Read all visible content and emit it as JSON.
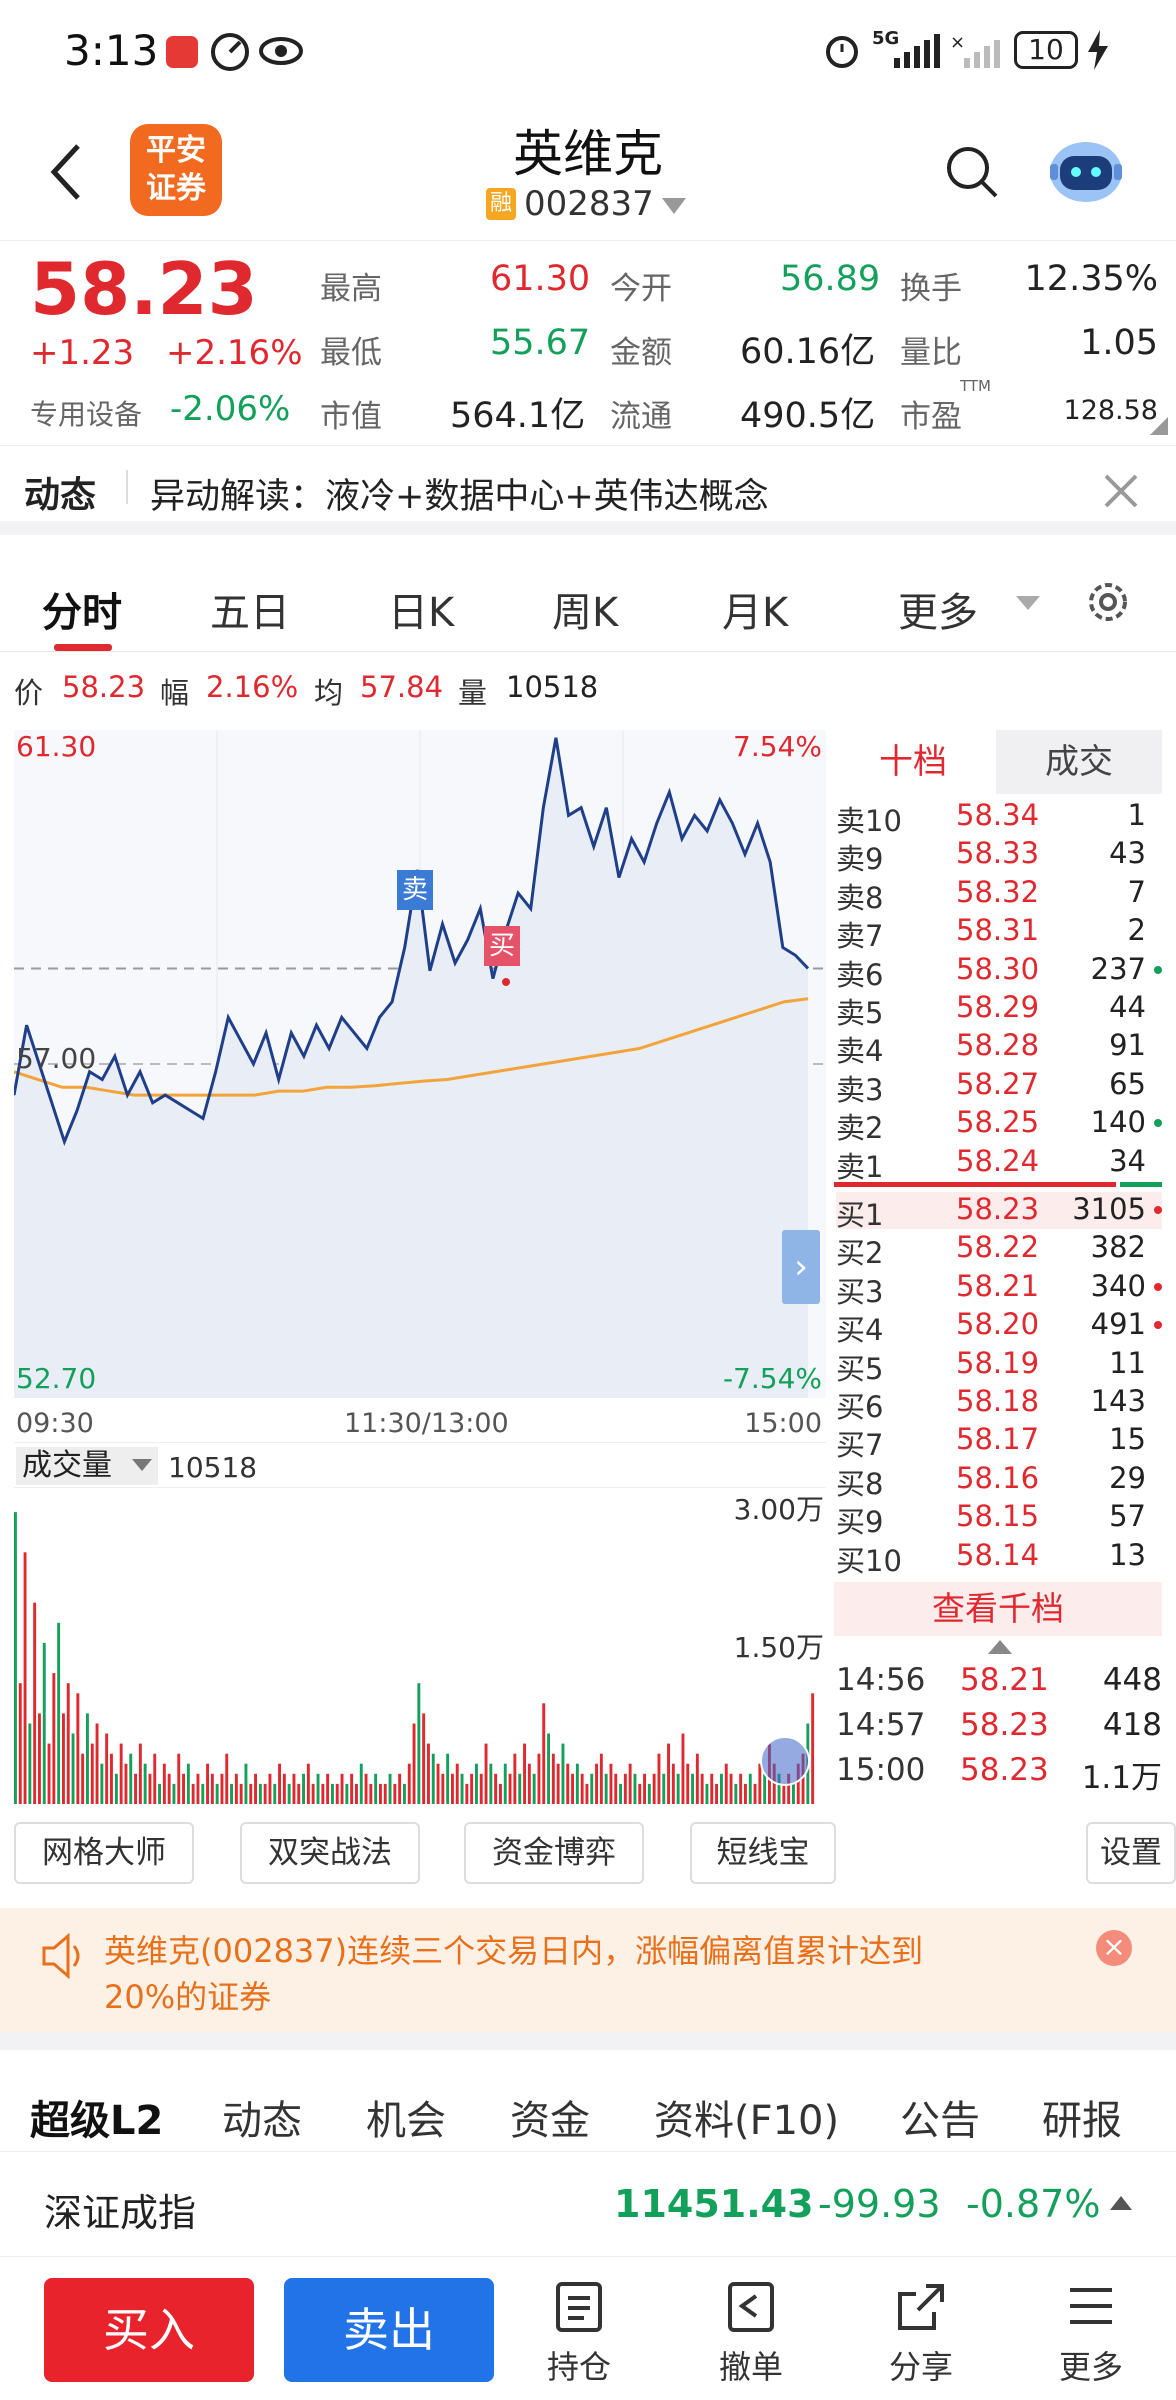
{
  "status": {
    "time": "3:13",
    "network": "5G",
    "battery": "10"
  },
  "header": {
    "title": "英维克",
    "badge": "融",
    "code": "002837",
    "logo_line1": "平安",
    "logo_line2": "证券"
  },
  "quote": {
    "price": "58.23",
    "change": "+1.23",
    "change_pct": "+2.16%",
    "sector": "专用设备",
    "sector_pct": "-2.06%",
    "high_label": "最高",
    "high": "61.30",
    "open_label": "今开",
    "open": "56.89",
    "turnover_label": "换手",
    "turnover": "12.35%",
    "low_label": "最低",
    "low": "55.67",
    "amount_label": "金额",
    "amount": "60.16亿",
    "vol_ratio_label": "量比",
    "vol_ratio": "1.05",
    "mktcap_label": "市值",
    "mktcap": "564.1亿",
    "float_label": "流通",
    "float": "490.5亿",
    "pe_label": "市盈",
    "pe_sup": "TTM",
    "pe": "128.58"
  },
  "news": {
    "label": "动态",
    "text": "异动解读：液冷+数据中心+英伟达概念"
  },
  "tabs": [
    "分时",
    "五日",
    "日K",
    "周K",
    "月K",
    "更多"
  ],
  "info": {
    "price_label": "价",
    "price": "58.23",
    "pct_label": "幅",
    "pct": "2.16%",
    "avg_label": "均",
    "avg": "57.84",
    "vol_label": "量",
    "vol": "10518"
  },
  "chart_data": {
    "type": "line",
    "ylim": [
      52.7,
      61.3
    ],
    "y_top": "61.30",
    "y_mid": "57.00",
    "y_bottom": "52.70",
    "pct_top": "7.54%",
    "pct_bottom": "-7.54%",
    "x_labels": [
      "09:30",
      "11:30/13:00",
      "15:00"
    ],
    "markers": {
      "sell": "卖",
      "buy": "买"
    },
    "series": [
      {
        "values": [
          56.6,
          57.5,
          57.0,
          56.5,
          56.0,
          56.4,
          56.9,
          56.8,
          57.1,
          56.6,
          56.9,
          56.5,
          56.6,
          56.5,
          56.4,
          56.3,
          56.9,
          57.6,
          57.3,
          57.0,
          57.4,
          56.8,
          57.4,
          57.1,
          57.5,
          57.2,
          57.6,
          57.4,
          57.2,
          57.6,
          57.8,
          58.5,
          59.5,
          58.2,
          58.8,
          58.3,
          58.6,
          59.0,
          58.1,
          58.7,
          59.2,
          59.0,
          60.3,
          61.2,
          60.2,
          60.3,
          59.8,
          60.3,
          59.4,
          59.9,
          59.6,
          60.1,
          60.5,
          59.9,
          60.2,
          60.0,
          60.4,
          60.1,
          59.7,
          60.1,
          59.6,
          58.5,
          58.4,
          58.23
        ]
      },
      {
        "values": [
          56.9,
          56.8,
          56.7,
          56.7,
          56.65,
          56.6,
          56.6,
          56.6,
          56.6,
          56.6,
          56.6,
          56.65,
          56.65,
          56.7,
          56.7,
          56.72,
          56.75,
          56.78,
          56.8,
          56.85,
          56.9,
          56.95,
          57.0,
          57.05,
          57.1,
          57.15,
          57.2,
          57.3,
          57.4,
          57.5,
          57.6,
          57.7,
          57.8,
          57.84
        ]
      }
    ],
    "volume": {
      "ylabels": [
        "3.00万",
        "1.50万"
      ],
      "values": [
        2.9,
        1.2,
        2.5,
        0.8,
        2.0,
        0.9,
        1.6,
        0.6,
        1.3,
        1.8,
        0.9,
        1.2,
        0.7,
        1.1,
        0.5,
        0.9,
        0.6,
        0.8,
        0.4,
        0.7,
        0.5,
        0.3,
        0.6,
        0.4,
        0.5,
        0.3,
        0.6,
        0.4,
        0.3,
        0.5,
        0.2,
        0.4,
        0.3,
        0.2,
        0.5,
        0.3,
        0.4,
        0.2,
        0.3,
        0.2,
        0.4,
        0.3,
        0.2,
        0.3,
        0.5,
        0.2,
        0.3,
        0.2,
        0.4,
        0.2,
        0.3,
        0.2,
        0.2,
        0.3,
        0.2,
        0.4,
        0.3,
        0.2,
        0.3,
        0.2,
        0.3,
        0.4,
        0.2,
        0.3,
        0.2,
        0.3,
        0.2,
        0.2,
        0.3,
        0.2,
        0.3,
        0.2,
        0.4,
        0.3,
        0.2,
        0.3,
        0.2,
        0.2,
        0.3,
        0.2,
        0.3,
        0.2,
        0.4,
        0.8,
        1.2,
        0.9,
        0.6,
        0.5,
        0.4,
        0.3,
        0.5,
        0.3,
        0.4,
        0.3,
        0.2,
        0.3,
        0.4,
        0.3,
        0.6,
        0.4,
        0.3,
        0.2,
        0.4,
        0.3,
        0.5,
        0.3,
        0.6,
        0.4,
        0.3,
        0.5,
        1.0,
        0.7,
        0.5,
        0.4,
        0.6,
        0.4,
        0.3,
        0.4,
        0.3,
        0.2,
        0.3,
        0.4,
        0.5,
        0.3,
        0.4,
        0.3,
        0.2,
        0.3,
        0.4,
        0.3,
        0.2,
        0.3,
        0.2,
        0.3,
        0.5,
        0.3,
        0.6,
        0.4,
        0.3,
        0.7,
        0.4,
        0.3,
        0.5,
        0.3,
        0.2,
        0.3,
        0.2,
        0.3,
        0.4,
        0.3,
        0.2,
        0.3,
        0.2,
        0.3,
        0.2,
        0.4,
        0.3,
        0.6,
        0.4,
        0.3,
        0.2,
        0.3,
        0.2,
        0.4,
        0.5,
        0.8,
        1.1
      ]
    }
  },
  "volhead": {
    "label": "成交量",
    "value": "10518"
  },
  "book": {
    "tab_active": "十档",
    "tab_other": "成交",
    "asks": [
      {
        "label": "卖10",
        "price": "58.34",
        "vol": "1",
        "dot": ""
      },
      {
        "label": "卖9",
        "price": "58.33",
        "vol": "43",
        "dot": ""
      },
      {
        "label": "卖8",
        "price": "58.32",
        "vol": "7",
        "dot": ""
      },
      {
        "label": "卖7",
        "price": "58.31",
        "vol": "2",
        "dot": ""
      },
      {
        "label": "卖6",
        "price": "58.30",
        "vol": "237",
        "dot": "#12a05a"
      },
      {
        "label": "卖5",
        "price": "58.29",
        "vol": "44",
        "dot": ""
      },
      {
        "label": "卖4",
        "price": "58.28",
        "vol": "91",
        "dot": ""
      },
      {
        "label": "卖3",
        "price": "58.27",
        "vol": "65",
        "dot": ""
      },
      {
        "label": "卖2",
        "price": "58.25",
        "vol": "140",
        "dot": "#12a05a"
      },
      {
        "label": "卖1",
        "price": "58.24",
        "vol": "34",
        "dot": ""
      }
    ],
    "bids": [
      {
        "label": "买1",
        "price": "58.23",
        "vol": "3105",
        "dot": "#e0282f"
      },
      {
        "label": "买2",
        "price": "58.22",
        "vol": "382",
        "dot": ""
      },
      {
        "label": "买3",
        "price": "58.21",
        "vol": "340",
        "dot": "#e0282f"
      },
      {
        "label": "买4",
        "price": "58.20",
        "vol": "491",
        "dot": "#e0282f"
      },
      {
        "label": "买5",
        "price": "58.19",
        "vol": "11",
        "dot": ""
      },
      {
        "label": "买6",
        "price": "58.18",
        "vol": "143",
        "dot": ""
      },
      {
        "label": "买7",
        "price": "58.17",
        "vol": "15",
        "dot": ""
      },
      {
        "label": "买8",
        "price": "58.16",
        "vol": "29",
        "dot": ""
      },
      {
        "label": "买9",
        "price": "58.15",
        "vol": "57",
        "dot": ""
      },
      {
        "label": "买10",
        "price": "58.14",
        "vol": "13",
        "dot": ""
      }
    ],
    "view_more": "查看千档",
    "trades": [
      {
        "time": "14:56",
        "price": "58.21",
        "vol": "448"
      },
      {
        "time": "14:57",
        "price": "58.23",
        "vol": "418"
      },
      {
        "time": "15:00",
        "price": "58.23",
        "vol": "1.1万"
      }
    ]
  },
  "tools": [
    "网格大师",
    "双突战法",
    "资金博弈",
    "短线宝",
    "设置"
  ],
  "warning": {
    "line1": "英维克(002837)连续三个交易日内，涨幅偏离值累计达到",
    "line2": "20%的证券"
  },
  "bottom_tabs": [
    "超级L2",
    "动态",
    "机会",
    "资金",
    "资料(F10)",
    "公告",
    "研报"
  ],
  "index": {
    "name": "深证成指",
    "value": "11451.43",
    "change": "-99.93",
    "pct": "-0.87%"
  },
  "actions": {
    "buy": "买入",
    "sell": "卖出",
    "hold": "持仓",
    "cancel": "撤单",
    "share": "分享",
    "more": "更多"
  },
  "colors": {
    "red": "#e0282f",
    "green": "#12a05a",
    "blue": "#1e6fe6",
    "line": "#1f3f8a",
    "avg": "#f2a33a"
  }
}
